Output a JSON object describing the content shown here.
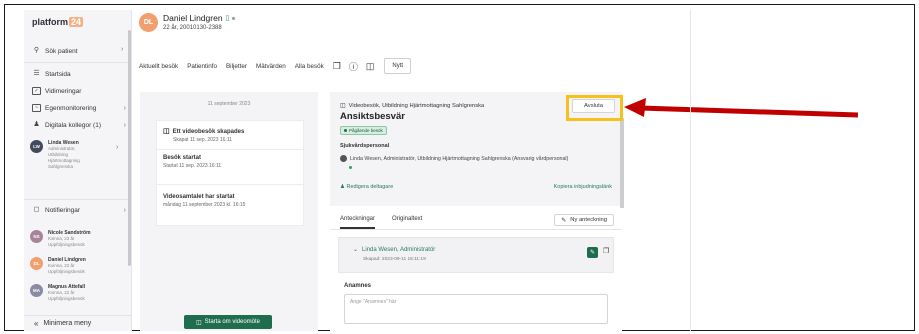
{
  "brand": {
    "name": "platform",
    "num": "24"
  },
  "sidebar": {
    "items": [
      {
        "label": "Sök patient",
        "icon": "search-icon"
      },
      {
        "label": "Startsida",
        "icon": "list-icon"
      },
      {
        "label": "Vidimeringar",
        "icon": "check-square-icon"
      },
      {
        "label": "Egenmonitorering",
        "icon": "monitor-icon"
      },
      {
        "label": "Digitala kollegor (1)",
        "icon": "people-icon"
      },
      {
        "label": "Notifieringar",
        "icon": "bell-icon"
      }
    ],
    "current_user": {
      "initials": "LW",
      "name": "Linda Wesen",
      "lines": [
        "Administratör,",
        "Utbildning",
        "Hjärtmottagning",
        "Sahlgrenska"
      ]
    },
    "patients": [
      {
        "initials": "NS",
        "name": "Nicole Sandström",
        "line1": "Kvinna, 23 år",
        "line2": "Uppföljningsbesök",
        "color": "#a8839a"
      },
      {
        "initials": "DL",
        "name": "Daniel Lindgren",
        "line1": "Kvinna, 22 år",
        "line2": "Uppföljningsbesök",
        "color": "#f0a06e"
      },
      {
        "initials": "MA",
        "name": "Magnus Attefall",
        "line1": "Kvinna, 22 år",
        "line2": "Uppföljningsbesök",
        "color": "#8a8aa6"
      }
    ],
    "minimize_label": "Minimera meny"
  },
  "patient": {
    "initials": "DL",
    "name": "Daniel Lindgren",
    "sub": "22 år, 20010130-2388"
  },
  "tabs": [
    "Aktuellt besök",
    "Patientinfo",
    "Biljetter",
    "Mätvärden",
    "Alla besök"
  ],
  "tab_new": "Nytt",
  "timeline": {
    "date": "11 september 2023",
    "events": [
      {
        "title": "Ett videobesök skapades",
        "sub": "Skapat 11 sep. 2023 16:11"
      },
      {
        "title": "Besök startat",
        "sub": "Startat 11 sep. 2023 16:11"
      },
      {
        "title": "Videosamtalet har startat",
        "sub": "måndag 11 september 2023 kl. 16:15"
      }
    ],
    "restart_label": "Starta om videomöte"
  },
  "visit": {
    "type": "Videobesök, Utbildning Hjärtmottagning Sahlgrenska",
    "title": "Ansiktsbesvär",
    "status": "Pågående besök",
    "end_label": "Avsluta",
    "staff_label": "Sjukvårdspersonal",
    "staff_member": "Linda Wesen, Administratör, Utbildning Hjärtmottagning Sahlgrenska (Ansvarig vårdpersonal)",
    "edit_participants": "Redigera deltagare",
    "copy_link": "Kopiera inbjudningslänk"
  },
  "notes": {
    "tab_notes": "Anteckningar",
    "tab_original": "Originaltext",
    "new_note": "Ny anteckning",
    "author": "Linda Wesen, Administratör",
    "created": "Skapad: 2023-09-11 16:11:19",
    "section": "Anamnes",
    "placeholder": "Ange \"Anamnes\" här"
  },
  "colors": {
    "accent": "#1f6d4f",
    "highlight": "#f6c11b",
    "arrow": "#c00000"
  }
}
